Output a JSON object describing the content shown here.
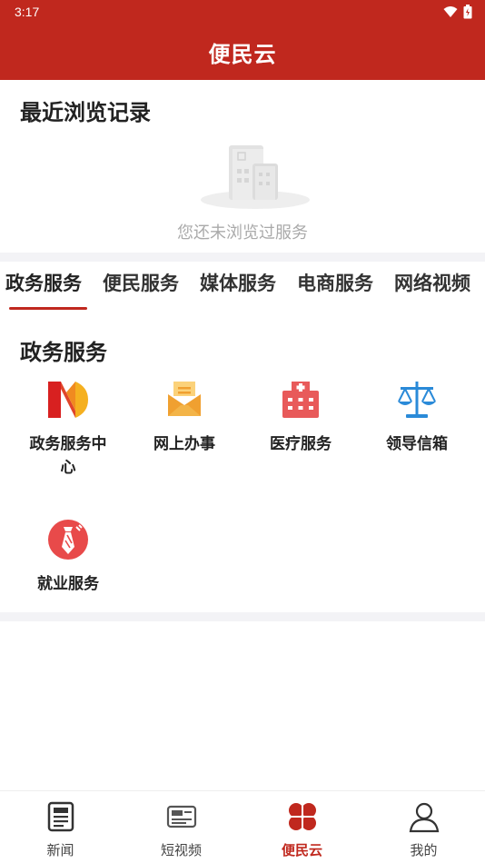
{
  "status_bar": {
    "time": "3:17",
    "icons": [
      "wifi-icon",
      "battery-icon"
    ]
  },
  "header": {
    "title": "便民云"
  },
  "recent": {
    "title": "最近浏览记录",
    "empty_text": "您还未浏览过服务",
    "illustration": "empty-buildings-icon"
  },
  "tabs": [
    {
      "label": "政务服务",
      "active": true
    },
    {
      "label": "便民服务",
      "active": false
    },
    {
      "label": "媒体服务",
      "active": false
    },
    {
      "label": "电商服务",
      "active": false
    },
    {
      "label": "网络视频",
      "active": false
    }
  ],
  "gov": {
    "title": "政务服务",
    "items": [
      {
        "label": "政务服务中心",
        "icon": "gov-center-logo-icon"
      },
      {
        "label": "网上办事",
        "icon": "online-affairs-icon"
      },
      {
        "label": "医疗服务",
        "icon": "hospital-icon"
      },
      {
        "label": "领导信箱",
        "icon": "scales-icon"
      },
      {
        "label": "就业服务",
        "icon": "employment-tie-icon"
      }
    ]
  },
  "bottom_nav": [
    {
      "label": "新闻",
      "icon": "news-icon",
      "active": false
    },
    {
      "label": "短视频",
      "icon": "video-icon",
      "active": false
    },
    {
      "label": "便民云",
      "icon": "clover-icon",
      "active": true
    },
    {
      "label": "我的",
      "icon": "user-icon",
      "active": false
    }
  ],
  "colors": {
    "brand": "#c0281e",
    "orange": "#f0a030",
    "medical": "#e85a5a",
    "scales": "#2a8ad8",
    "muted": "#aaaaaa"
  }
}
